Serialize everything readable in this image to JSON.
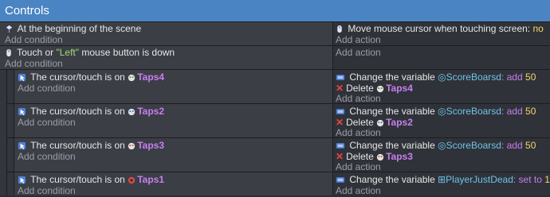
{
  "header": {
    "title": "Controls"
  },
  "add_condition": "Add condition",
  "add_action": "Add action",
  "events": [
    {
      "condition": {
        "text": "At the beginning of the scene"
      },
      "actions": [
        {
          "type": "setting",
          "text": "Move mouse cursor when touching screen:",
          "value": "no"
        }
      ]
    },
    {
      "condition": {
        "text_a": "Touch or ",
        "text_b": "\"Left\"",
        "text_c": " mouse button is down"
      },
      "actions": []
    },
    {
      "condition": {
        "text": "The cursor/touch is on",
        "object": "Taps4"
      },
      "actions": [
        {
          "type": "var",
          "text": "Change the variable",
          "variable": "ScoreBoarsd",
          "op": ": add",
          "value": "50"
        },
        {
          "type": "delete",
          "text": "Delete",
          "object": "Taps4"
        }
      ]
    },
    {
      "condition": {
        "text": "The cursor/touch is on",
        "object": "Taps2"
      },
      "actions": [
        {
          "type": "var",
          "text": "Change the variable",
          "variable": "ScoreBoarsd",
          "op": ": add",
          "value": "50"
        },
        {
          "type": "delete",
          "text": "Delete",
          "object": "Taps2"
        }
      ]
    },
    {
      "condition": {
        "text": "The cursor/touch is on",
        "object": "Taps3"
      },
      "actions": [
        {
          "type": "var",
          "text": "Change the variable",
          "variable": "ScoreBoarsd",
          "op": ": add",
          "value": "50"
        },
        {
          "type": "delete",
          "text": "Delete",
          "object": "Taps3"
        }
      ]
    },
    {
      "condition": {
        "text": "The cursor/touch is on",
        "object": "Taps1"
      },
      "actions": [
        {
          "type": "var",
          "text": "Change the variable",
          "variable": "PlayerJustDead",
          "op": ": set to",
          "value": "1"
        }
      ]
    }
  ]
}
